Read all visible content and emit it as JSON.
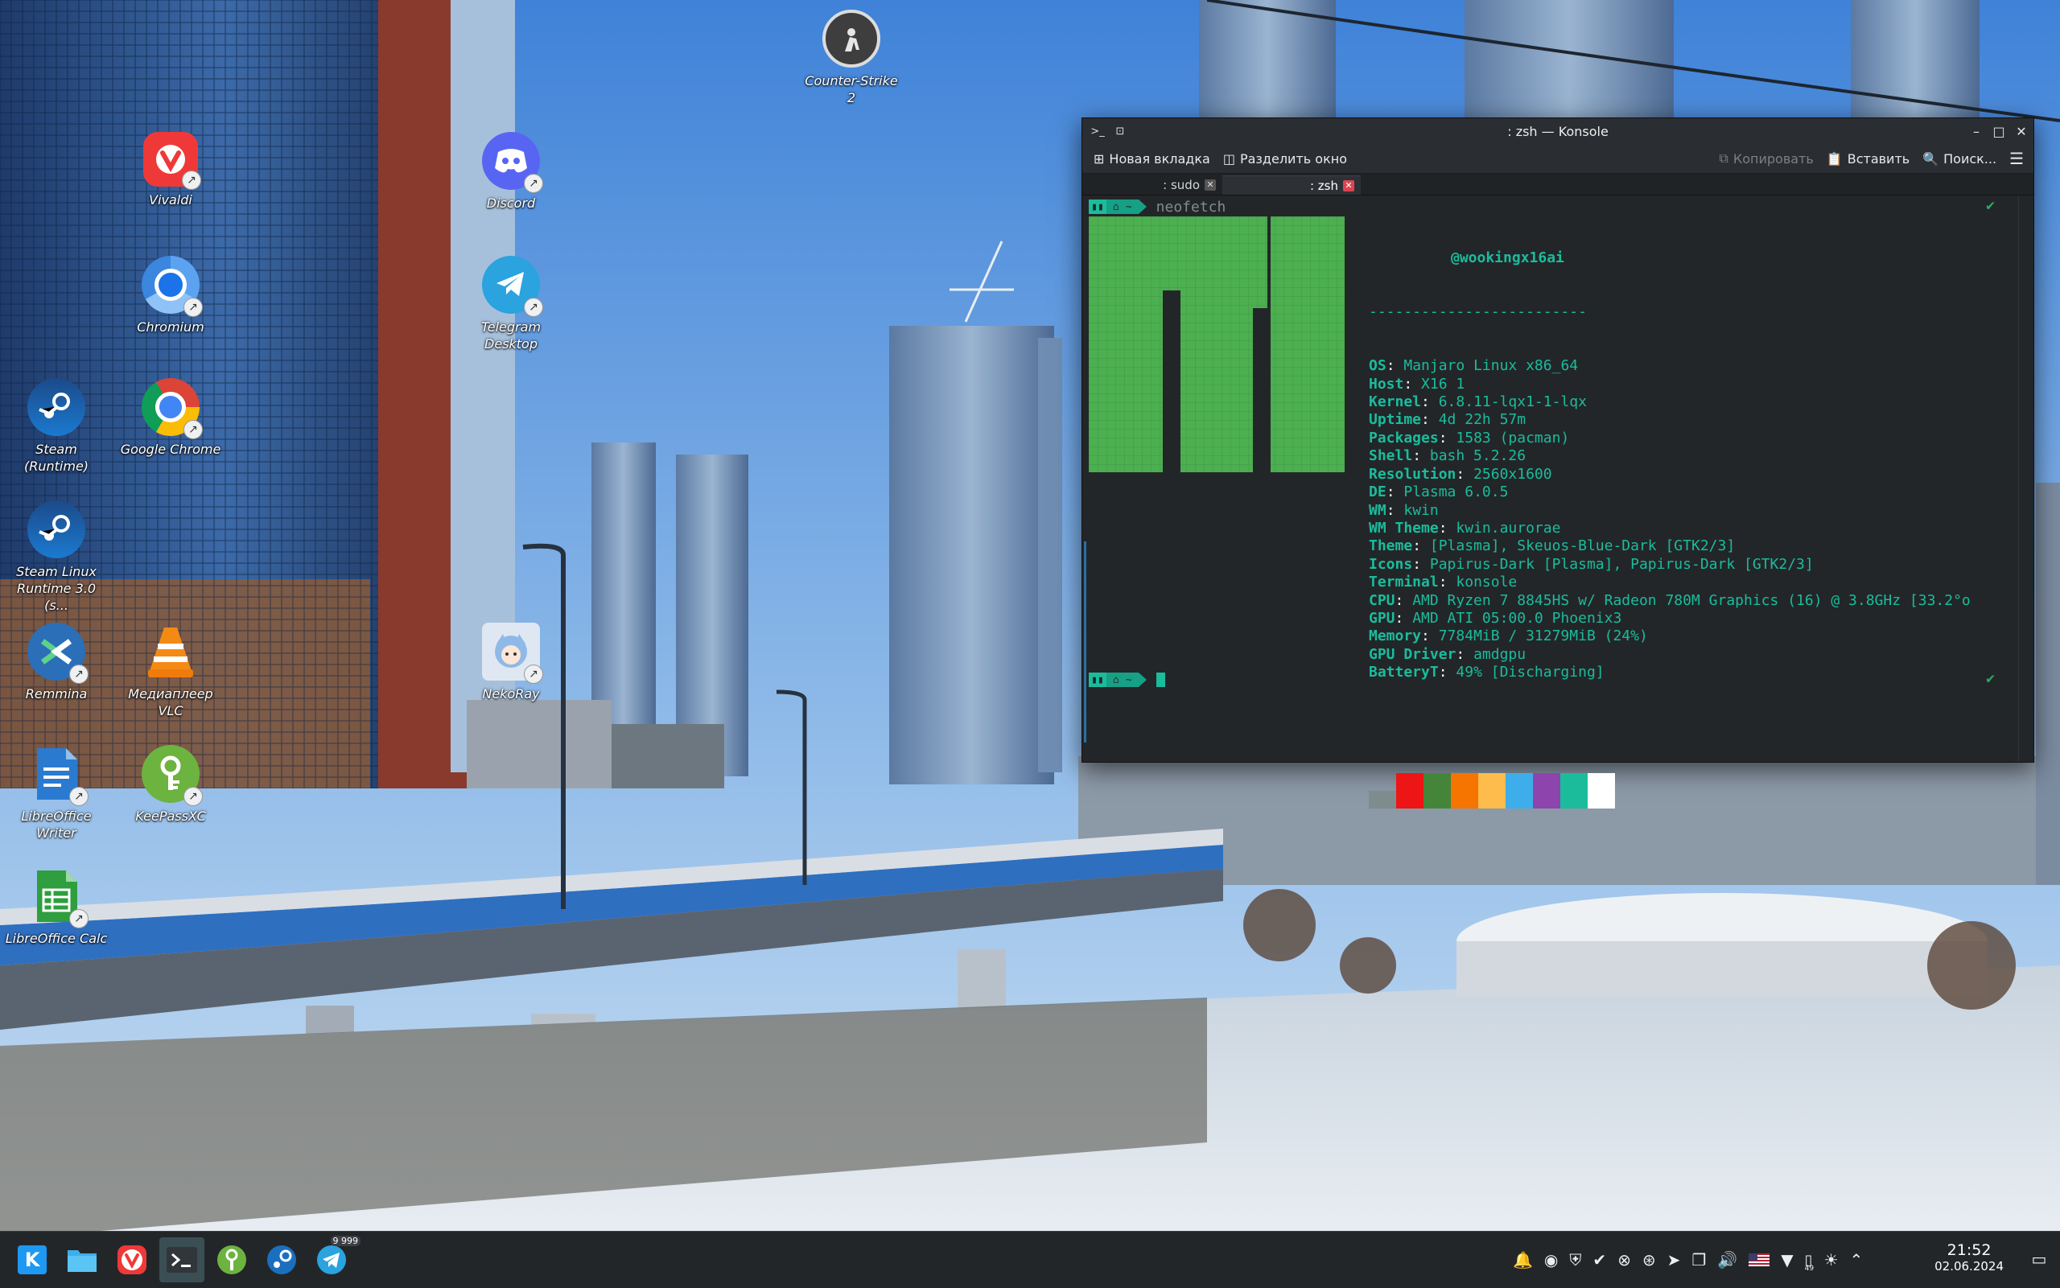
{
  "colors": {
    "konsole_bg": "#232629",
    "accent_teal": "#1abc9c",
    "manjaro_green": "#4caf50",
    "taskbar_bg": "#232629"
  },
  "desktop": {
    "icons": [
      {
        "id": "counter-strike-2",
        "label": "Counter-Strike 2",
        "icon": "counter-strike-icon"
      },
      {
        "id": "vivaldi",
        "label": "Vivaldi",
        "icon": "vivaldi-icon"
      },
      {
        "id": "discord",
        "label": "Discord",
        "icon": "discord-icon"
      },
      {
        "id": "chromium",
        "label": "Chromium",
        "icon": "chromium-icon"
      },
      {
        "id": "telegram",
        "label": "Telegram Desktop",
        "icon": "telegram-icon"
      },
      {
        "id": "steam-runtime",
        "label": "Steam (Runtime)",
        "icon": "steam-icon"
      },
      {
        "id": "google-chrome",
        "label": "Google Chrome",
        "icon": "chrome-icon"
      },
      {
        "id": "steam-linux-runtime",
        "label": "Steam Linux Runtime 3.0 (s...",
        "icon": "steam-icon"
      },
      {
        "id": "remmina",
        "label": "Remmina",
        "icon": "remmina-icon"
      },
      {
        "id": "vlc",
        "label": "Медиаплеер VLC",
        "icon": "vlc-icon"
      },
      {
        "id": "nekoray",
        "label": "NekoRay",
        "icon": "nekoray-icon"
      },
      {
        "id": "libreoffice-writer",
        "label": "LibreOffice Writer",
        "icon": "writer-icon"
      },
      {
        "id": "keepassxc",
        "label": "KeePassXC",
        "icon": "keepassxc-icon"
      },
      {
        "id": "libreoffice-calc",
        "label": "LibreOffice Calc",
        "icon": "calc-icon"
      }
    ]
  },
  "konsole": {
    "title": ": zsh — Konsole",
    "toolbar": {
      "new_tab": "Новая вкладка",
      "split_view": "Разделить окно",
      "copy": "Копировать",
      "paste": "Вставить",
      "search": "Поиск..."
    },
    "tabs": [
      {
        "label": ": sudo",
        "active": false
      },
      {
        "label": ": zsh",
        "active": true
      }
    ],
    "terminal": {
      "prompt_home": "~",
      "command": "neofetch",
      "userhost": "@wookingx16ai",
      "separator": "-------------------------",
      "info": [
        {
          "key": "OS",
          "value": "Manjaro Linux x86_64"
        },
        {
          "key": "Host",
          "value": "X16 1"
        },
        {
          "key": "Kernel",
          "value": "6.8.11-lqx1-1-lqx"
        },
        {
          "key": "Uptime",
          "value": "4d 22h 57m"
        },
        {
          "key": "Packages",
          "value": "1583 (pacman)"
        },
        {
          "key": "Shell",
          "value": "bash 5.2.26"
        },
        {
          "key": "Resolution",
          "value": "2560x1600"
        },
        {
          "key": "DE",
          "value": "Plasma 6.0.5"
        },
        {
          "key": "WM",
          "value": "kwin"
        },
        {
          "key": "WM Theme",
          "value": "kwin.aurorae"
        },
        {
          "key": "Theme",
          "value": "[Plasma], Skeuos-Blue-Dark [GTK2/3]"
        },
        {
          "key": "Icons",
          "value": "Papirus-Dark [Plasma], Papirus-Dark [GTK2/3]"
        },
        {
          "key": "Terminal",
          "value": "konsole"
        },
        {
          "key": "CPU",
          "value": "AMD Ryzen 7 8845HS w/ Radeon 780M Graphics (16) @ 3.8GHz [33.2°o"
        },
        {
          "key": "GPU",
          "value": "AMD ATI 05:00.0 Phoenix3"
        },
        {
          "key": "Memory",
          "value": "7784MiB / 31279MiB (24%)"
        },
        {
          "key": "GPU Driver",
          "value": "amdgpu"
        },
        {
          "key": "BatteryT",
          "value": "49% [Discharging]"
        }
      ],
      "palette": [
        "#7f8c8d",
        "#ed1515",
        "#44853a",
        "#f67400",
        "#fdbc4b",
        "#3daee9",
        "#8e44ad",
        "#1abc9c",
        "#ffffff"
      ]
    }
  },
  "taskbar": {
    "apps": [
      {
        "name": "application-launcher",
        "icon": "kde-launcher-icon",
        "active": false
      },
      {
        "name": "file-manager",
        "icon": "folder-icon",
        "active": false
      },
      {
        "name": "vivaldi",
        "icon": "vivaldi-icon",
        "active": false
      },
      {
        "name": "konsole",
        "icon": "terminal-icon",
        "active": true
      },
      {
        "name": "keepassxc",
        "icon": "keepassxc-icon",
        "active": false
      },
      {
        "name": "steam",
        "icon": "steam-icon",
        "active": false
      },
      {
        "name": "telegram",
        "icon": "telegram-icon",
        "active": false,
        "badge": "9 999"
      }
    ],
    "tray_battery": "49",
    "clock": {
      "time": "21:52",
      "date": "02.06.2024"
    }
  }
}
